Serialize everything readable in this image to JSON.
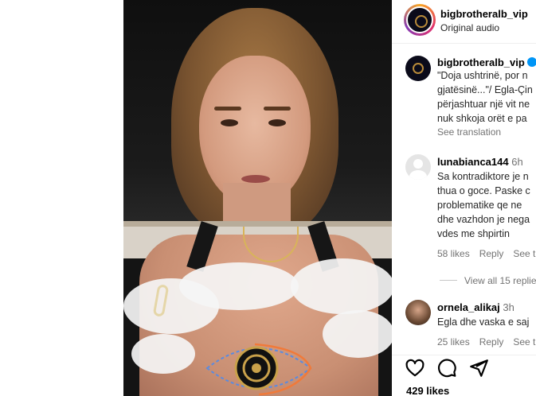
{
  "post": {
    "username": "bigbrotheralb_vip",
    "audio": "Original audio",
    "caption_username": "bigbrotheralb_vip",
    "caption_lines": [
      "\"Doja ushtrinë, por n",
      "gjatësinë...\"/ Egla-Çin",
      "përjashtuar një vit ne",
      "nuk shkoja orët e pa"
    ],
    "see_translation": "See translation",
    "likes": "429 likes"
  },
  "comments": [
    {
      "username": "lunabianca144",
      "time": "6h",
      "lines": [
        "Sa kontradiktore je n",
        "thua o goce. Paske c",
        "problematike qe ne",
        "dhe vazhdon je nega",
        "vdes me shpirtin"
      ],
      "likes": "58 likes",
      "reply": "Reply",
      "see_translation": "See tr"
    },
    {
      "username": "ornela_alikaj",
      "time": "3h",
      "lines": [
        "Egla dhe vaska e saj"
      ],
      "likes": "25 likes",
      "reply": "Reply",
      "see_translation": "See tr"
    }
  ],
  "view_replies": "View all 15 replie",
  "icons": {
    "like": "heart-icon",
    "comment": "comment-icon",
    "share": "send-icon"
  },
  "colors": {
    "verified": "#0095f6",
    "muted": "#737373",
    "text": "#262626"
  }
}
